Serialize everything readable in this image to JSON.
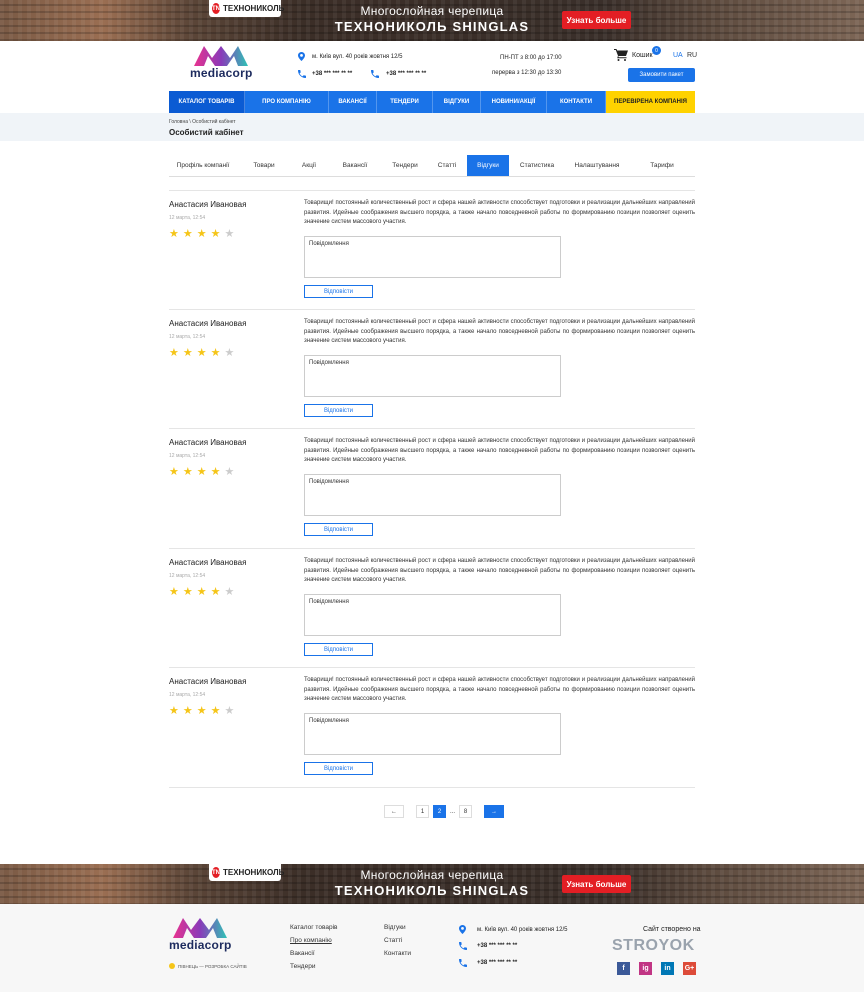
{
  "top_banner": {
    "brand": "ТЕХНОНИКОЛЬ",
    "line1": "Многослойная черепица",
    "line2": "ТЕХНОНИКОЛЬ SHINGLAS",
    "cta": "Узнать больше"
  },
  "header": {
    "logo": "mediacorp",
    "address": "м. Київ вул. 40 років жовтня 12/5",
    "phone1": "+38 *** *** ** **",
    "phone2": "+38 *** *** ** **",
    "hours": "ПН-ПТ з 8:00 до 17:00",
    "break": "перерва з 12:30 до 13:30",
    "cart_label": "Кошик",
    "cart_count": "0",
    "lang_ua": "UA",
    "lang_ru": "RU",
    "order_button": "Замовити пакет"
  },
  "nav": {
    "items": [
      "КАТАЛОГ ТОВАРІВ",
      "ПРО КОМПАНІЮ",
      "ВАКАНСІЇ",
      "ТЕНДЕРИ",
      "ВІДГУКИ",
      "НОВИНИ/АКЦІЇ",
      "КОНТАКТИ",
      "ПЕРЕВІРЕНА КОМПАНІЯ"
    ]
  },
  "breadcrumb": "Головна \\ Особистий кабінет",
  "page_title": "Особистий кабінет",
  "tabs": [
    "Профіль компанії",
    "Товари",
    "Акції",
    "Вакансії",
    "Тендери",
    "Статті",
    "Відгуки",
    "Статистика",
    "Налаштування",
    "Тарифи"
  ],
  "active_tab": "Відгуки",
  "reviews": [
    {
      "name": "Анастасия Ивановая",
      "date": "12 марта, 12:54",
      "rating": 4,
      "text": "Товарищи! постоянный количественный рост и сфера нашей активности способствует подготовки и реализации дальнейших направлений развития. Идейные соображения высшего порядка, а также начало повседневной работы по формированию позиции позволяет оценить значение систем массового участия.",
      "placeholder": "Повідомлення",
      "reply": "Відповісти"
    },
    {
      "name": "Анастасия Ивановая",
      "date": "12 марта, 12:54",
      "rating": 4,
      "text": "Товарищи! постоянный количественный рост и сфера нашей активности способствует подготовки и реализации дальнейших направлений развития. Идейные соображения высшего порядка, а также начало повседневной работы по формированию позиции позволяет оценить значение систем массового участия.",
      "placeholder": "Повідомлення",
      "reply": "Відповісти"
    },
    {
      "name": "Анастасия Ивановая",
      "date": "12 марта, 12:54",
      "rating": 4,
      "text": "Товарищи! постоянный количественный рост и сфера нашей активности способствует подготовки и реализации дальнейших направлений развития. Идейные соображения высшего порядка, а также начало повседневной работы по формированию позиции позволяет оценить значение систем массового участия.",
      "placeholder": "Повідомлення",
      "reply": "Відповісти"
    },
    {
      "name": "Анастасия Ивановая",
      "date": "12 марта, 12:54",
      "rating": 4,
      "text": "Товарищи! постоянный количественный рост и сфера нашей активности способствует подготовки и реализации дальнейших направлений развития. Идейные соображения высшего порядка, а также начало повседневной работы по формированию позиции позволяет оценить значение систем массового участия.",
      "placeholder": "Повідомлення",
      "reply": "Відповісти"
    },
    {
      "name": "Анастасия Ивановая",
      "date": "12 марта, 12:54",
      "rating": 4,
      "text": "Товарищи! постоянный количественный рост и сфера нашей активности способствует подготовки и реализации дальнейших направлений развития. Идейные соображения высшего порядка, а также начало повседневной работы по формированию позиции позволяет оценить значение систем массового участия.",
      "placeholder": "Повідомлення",
      "reply": "Відповісти"
    }
  ],
  "pagination": {
    "prev": "←",
    "pages": [
      "1",
      "2",
      "...",
      "8"
    ],
    "active": "2",
    "next": "→"
  },
  "footer": {
    "logo": "mediacorp",
    "tagline": "ПІВНЕЦЬ — РОЗРОБКА САЙТІВ",
    "col1": [
      "Каталог товарів",
      "Про компанію",
      "Вакансії",
      "Тендери"
    ],
    "col2": [
      "Відгуки",
      "Статті",
      "Контакти"
    ],
    "address": "м. Київ вул. 40 років жовтня 12/5",
    "phone1": "+38 *** *** ** **",
    "phone2": "+38 *** *** ** **",
    "created_by": "Сайт створено на",
    "stroy_logo": "STROYOK",
    "social": [
      "f",
      "ig",
      "in",
      "G+"
    ]
  },
  "colors": {
    "accent": "#1a73e8",
    "highlight": "#ffd200",
    "star": "#f5c518",
    "star_empty": "#cccccc",
    "banner_cta": "#e31e24"
  }
}
